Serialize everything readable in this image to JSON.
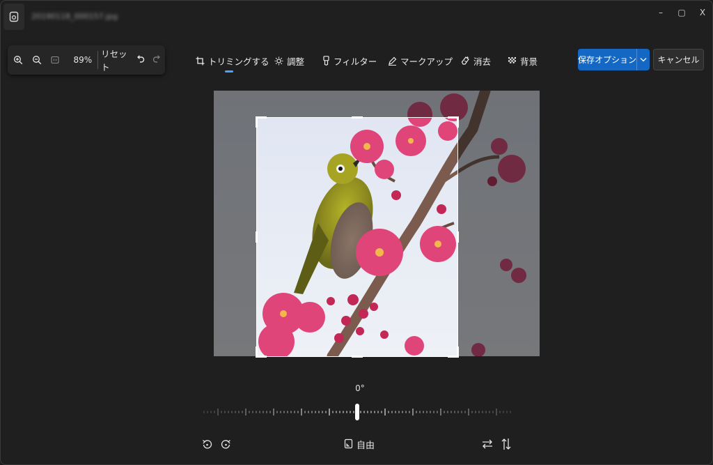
{
  "window": {
    "file_title": "20190118_000157.jpg",
    "controls": {
      "minimize": "–",
      "maximize": "▢",
      "close": "X"
    }
  },
  "zoom_toolbar": {
    "zoom_level": "89%",
    "reset_label": "リセット"
  },
  "tabs": [
    {
      "label": "トリミングする",
      "icon": "crop-icon",
      "selected": true
    },
    {
      "label": "調整",
      "icon": "brightness-icon",
      "selected": false
    },
    {
      "label": "フィルター",
      "icon": "filter-icon",
      "selected": false
    },
    {
      "label": "マークアップ",
      "icon": "markup-pen-icon",
      "selected": false
    },
    {
      "label": "消去",
      "icon": "erase-icon",
      "selected": false
    },
    {
      "label": "背景",
      "icon": "background-icon",
      "selected": false
    }
  ],
  "actions": {
    "save_label": "保存オプション",
    "cancel_label": "キャンセル"
  },
  "rotation": {
    "angle": "0°"
  },
  "aspect": {
    "label": "自由"
  },
  "colors": {
    "accent": "#1468c4",
    "tab_indicator": "#4aa3ff",
    "background": "#1f1f1f"
  }
}
